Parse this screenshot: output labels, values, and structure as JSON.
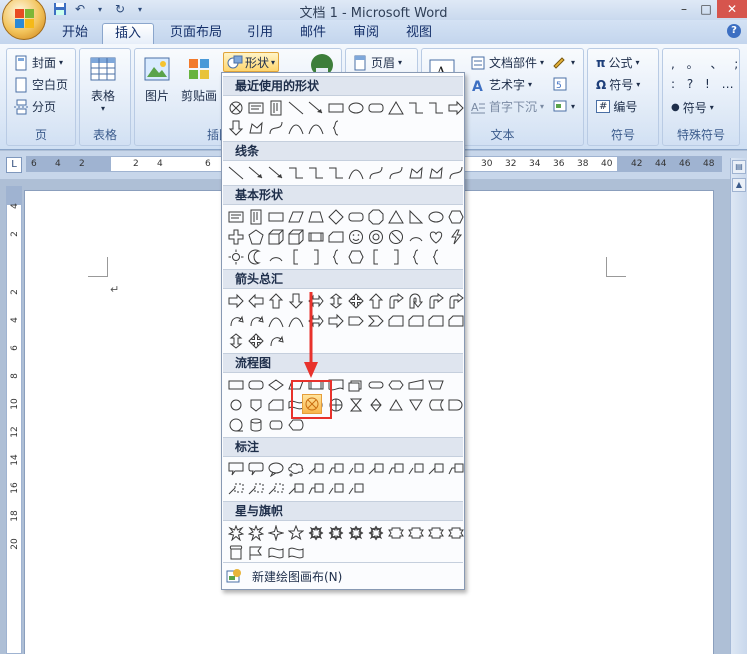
{
  "window": {
    "title": "文档 1 - Microsoft Word",
    "help_label": "?"
  },
  "tabs": [
    {
      "label": "开始"
    },
    {
      "label": "插入",
      "active": true
    },
    {
      "label": "页面布局"
    },
    {
      "label": "引用"
    },
    {
      "label": "邮件"
    },
    {
      "label": "审阅"
    },
    {
      "label": "视图"
    }
  ],
  "ribbon": {
    "pages_group": {
      "label": "页",
      "cover": "封面",
      "blank_page": "空白页",
      "page_break": "分页"
    },
    "table_group": {
      "label": "表格",
      "table": "表格"
    },
    "illustrations_group": {
      "label": "插图",
      "picture": "图片",
      "clipart": "剪贴画",
      "shapes": "形状"
    },
    "header_footer_group": {
      "header": "页眉"
    },
    "text_group": {
      "label": "文本",
      "quick_parts": "文档部件",
      "wordart": "艺术字",
      "dropcap": "首字下沉"
    },
    "symbols_group": {
      "label": "符号",
      "equation": "公式",
      "symbol": "符号",
      "numbering": "编号"
    },
    "special_group": {
      "label": "特殊符号",
      "row1": ", 。 、 ;",
      "row2": ": ? ! …",
      "symbol": "符号"
    }
  },
  "ruler": {
    "h_numbers": [
      "6",
      "4",
      "2",
      "2",
      "4",
      "6",
      "30",
      "32",
      "34",
      "36",
      "38",
      "40",
      "42",
      "44",
      "46",
      "48"
    ],
    "v_numbers": [
      "4",
      "2",
      "2",
      "4",
      "6",
      "8",
      "10",
      "12",
      "14",
      "16",
      "18",
      "20"
    ]
  },
  "shapes_menu": {
    "sections": [
      {
        "title": "最近使用的形状"
      },
      {
        "title": "线条"
      },
      {
        "title": "基本形状"
      },
      {
        "title": "箭头总汇"
      },
      {
        "title": "流程图"
      },
      {
        "title": "标注"
      },
      {
        "title": "星与旗帜"
      }
    ],
    "footer": "新建绘图画布(N)"
  },
  "colors": {
    "accent": "#e8322c",
    "hover": "#ffd66e"
  }
}
